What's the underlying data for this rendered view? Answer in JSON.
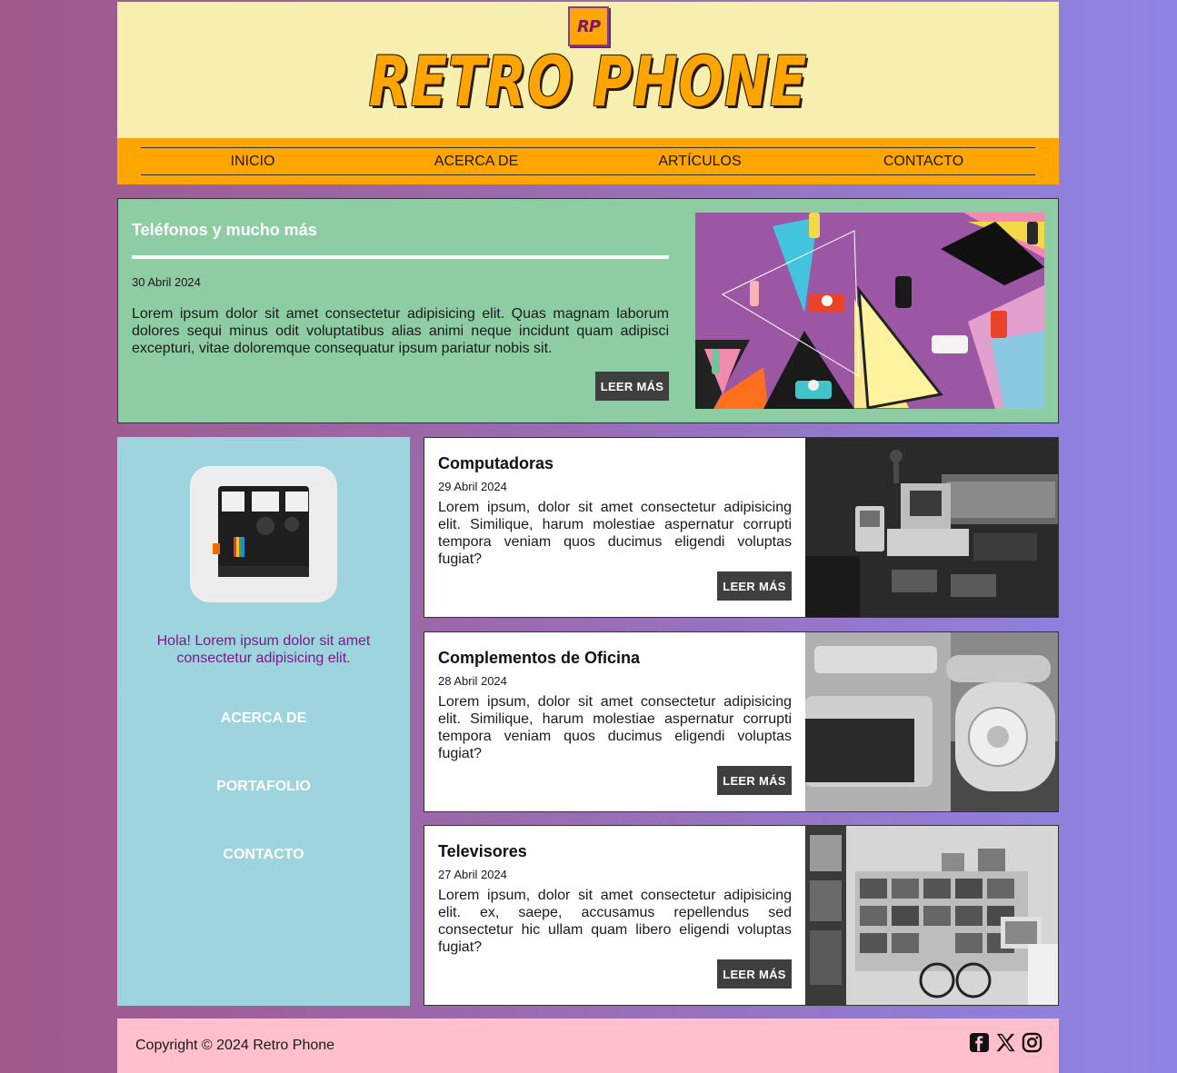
{
  "header": {
    "logo_badge": "RP",
    "title": "RETRO PHONE"
  },
  "nav": {
    "items": [
      "INICIO",
      "ACERCA DE",
      "ARTÍCULOS",
      "CONTACTO"
    ]
  },
  "hero": {
    "title": "Teléfonos y mucho más",
    "date": "30 Abril 2024",
    "text": "Lorem ipsum dolor sit amet consectetur adipisicing elit. Quas magnam laborum dolores sequi minus odit voluptatibus alias animi neque incidunt quam adipisci excepturi, vitae doloremque consequatur ipsum pariatur nobis sit.",
    "button": "LEER MÁS"
  },
  "sidebar": {
    "text": "Hola! Lorem ipsum dolor sit amet consectetur adipisicing elit.",
    "links": [
      "ACERCA DE",
      "PORTAFOLIO",
      "CONTACTO"
    ]
  },
  "cards": [
    {
      "title": "Computadoras",
      "date": "29 Abril 2024",
      "text": "Lorem ipsum, dolor sit amet consectetur adipisicing elit. Similique, harum molestiae aspernatur corrupti tempora veniam quos ducimus eligendi voluptas fugiat?",
      "button": "LEER MÁS"
    },
    {
      "title": "Complementos de Oficina",
      "date": "28 Abril 2024",
      "text": "Lorem ipsum, dolor sit amet consectetur adipisicing elit. Similique, harum molestiae aspernatur corrupti tempora veniam quos ducimus eligendi voluptas fugiat?",
      "button": "LEER MÁS"
    },
    {
      "title": "Televisores",
      "date": "27 Abril 2024",
      "text": "Lorem ipsum, dolor sit amet consectetur adipisicing elit. ex, saepe, accusamus repellendus sed consectetur hic ullam quam libero eligendi voluptas fugiat?",
      "button": "LEER MÁS"
    }
  ],
  "footer": {
    "copyright": "Copyright © 2024 Retro Phone",
    "social_icons": [
      "facebook-icon",
      "x-icon",
      "instagram-icon"
    ]
  },
  "colors": {
    "header_bg": "#f7efaf",
    "accent_orange": "#ffa500",
    "hero_bg": "#8ecca4",
    "sidebar_bg": "#9dd4de",
    "footer_bg": "#ffbfcc",
    "button_bg": "#3f3f3f",
    "sidebar_text": "#7a1a8a"
  }
}
